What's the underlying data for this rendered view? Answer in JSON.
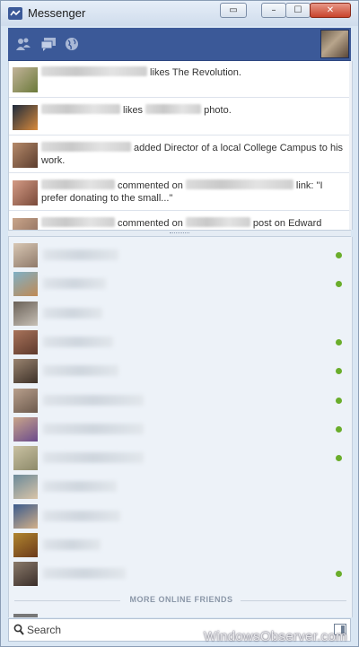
{
  "window": {
    "title": "Messenger"
  },
  "titlebar_buttons": {
    "popout": "▭",
    "minimize": "–",
    "maximize": "☐",
    "close": "✕"
  },
  "header": {
    "icons": [
      "friends-icon",
      "messages-icon",
      "globe-icon"
    ]
  },
  "ticker": [
    {
      "before": "",
      "after": " likes The Revolution.",
      "avatar": [
        "#c3b39a",
        "#6b7a3a"
      ],
      "blur1": 118,
      "blur2": 0,
      "middle": ""
    },
    {
      "before": "",
      "after": " photo.",
      "middle": " likes ",
      "avatar": [
        "#1e2b3d",
        "#d88a3b"
      ],
      "blur1": 88,
      "blur2": 62
    },
    {
      "before": "",
      "after": " added Director of a local College Campus to his work.",
      "avatar": [
        "#b58a6a",
        "#5c3d2e"
      ],
      "blur1": 100,
      "blur2": 0,
      "middle": ""
    },
    {
      "before": "",
      "after": " link: \"I prefer donating to the small...\"",
      "middle": " commented on ",
      "avatar": [
        "#d49b85",
        "#7a4a3a"
      ],
      "blur1": 82,
      "blur2": 120
    },
    {
      "before": "",
      "after": " post on Edward",
      "middle": " commented on ",
      "avatar": [
        "#c9a58a",
        "#8a6a5a"
      ],
      "blur1": 82,
      "blur2": 72
    }
  ],
  "friends": [
    {
      "online": true,
      "avatar": [
        "#d8c7b4",
        "#8f7a6a"
      ],
      "name_width": 84
    },
    {
      "online": true,
      "avatar": [
        "#7fb0c6",
        "#c08a55"
      ],
      "name_width": 70
    },
    {
      "online": false,
      "avatar": [
        "#6a6158",
        "#c7c0b6"
      ],
      "name_width": 66
    },
    {
      "online": true,
      "avatar": [
        "#a8735a",
        "#5e3a2d"
      ],
      "name_width": 78
    },
    {
      "online": true,
      "avatar": [
        "#9a8470",
        "#3d3128"
      ],
      "name_width": 84
    },
    {
      "online": true,
      "avatar": [
        "#b89f8c",
        "#6c5a4d"
      ],
      "name_width": 112
    },
    {
      "online": true,
      "avatar": [
        "#c9a58a",
        "#6b4b8c"
      ],
      "name_width": 112
    },
    {
      "online": true,
      "avatar": [
        "#c9c1a2",
        "#8d8a6a"
      ],
      "name_width": 112
    },
    {
      "online": false,
      "avatar": [
        "#6b8a9a",
        "#d9c4a8"
      ],
      "name_width": 82
    },
    {
      "online": false,
      "avatar": [
        "#3b5b8c",
        "#d2b08a"
      ],
      "name_width": 86
    },
    {
      "online": false,
      "avatar": [
        "#b0852f",
        "#6b3a1a"
      ],
      "name_width": 64
    },
    {
      "online": true,
      "avatar": [
        "#8a7a6a",
        "#3a2e2a"
      ],
      "name_width": 92
    }
  ],
  "more_online_label": "MORE ONLINE FRIENDS",
  "search": {
    "placeholder": "Search"
  },
  "watermark": "WindowsObserver.com",
  "colors": {
    "header_blue": "#3b5998",
    "online_green": "#6aad2b"
  }
}
